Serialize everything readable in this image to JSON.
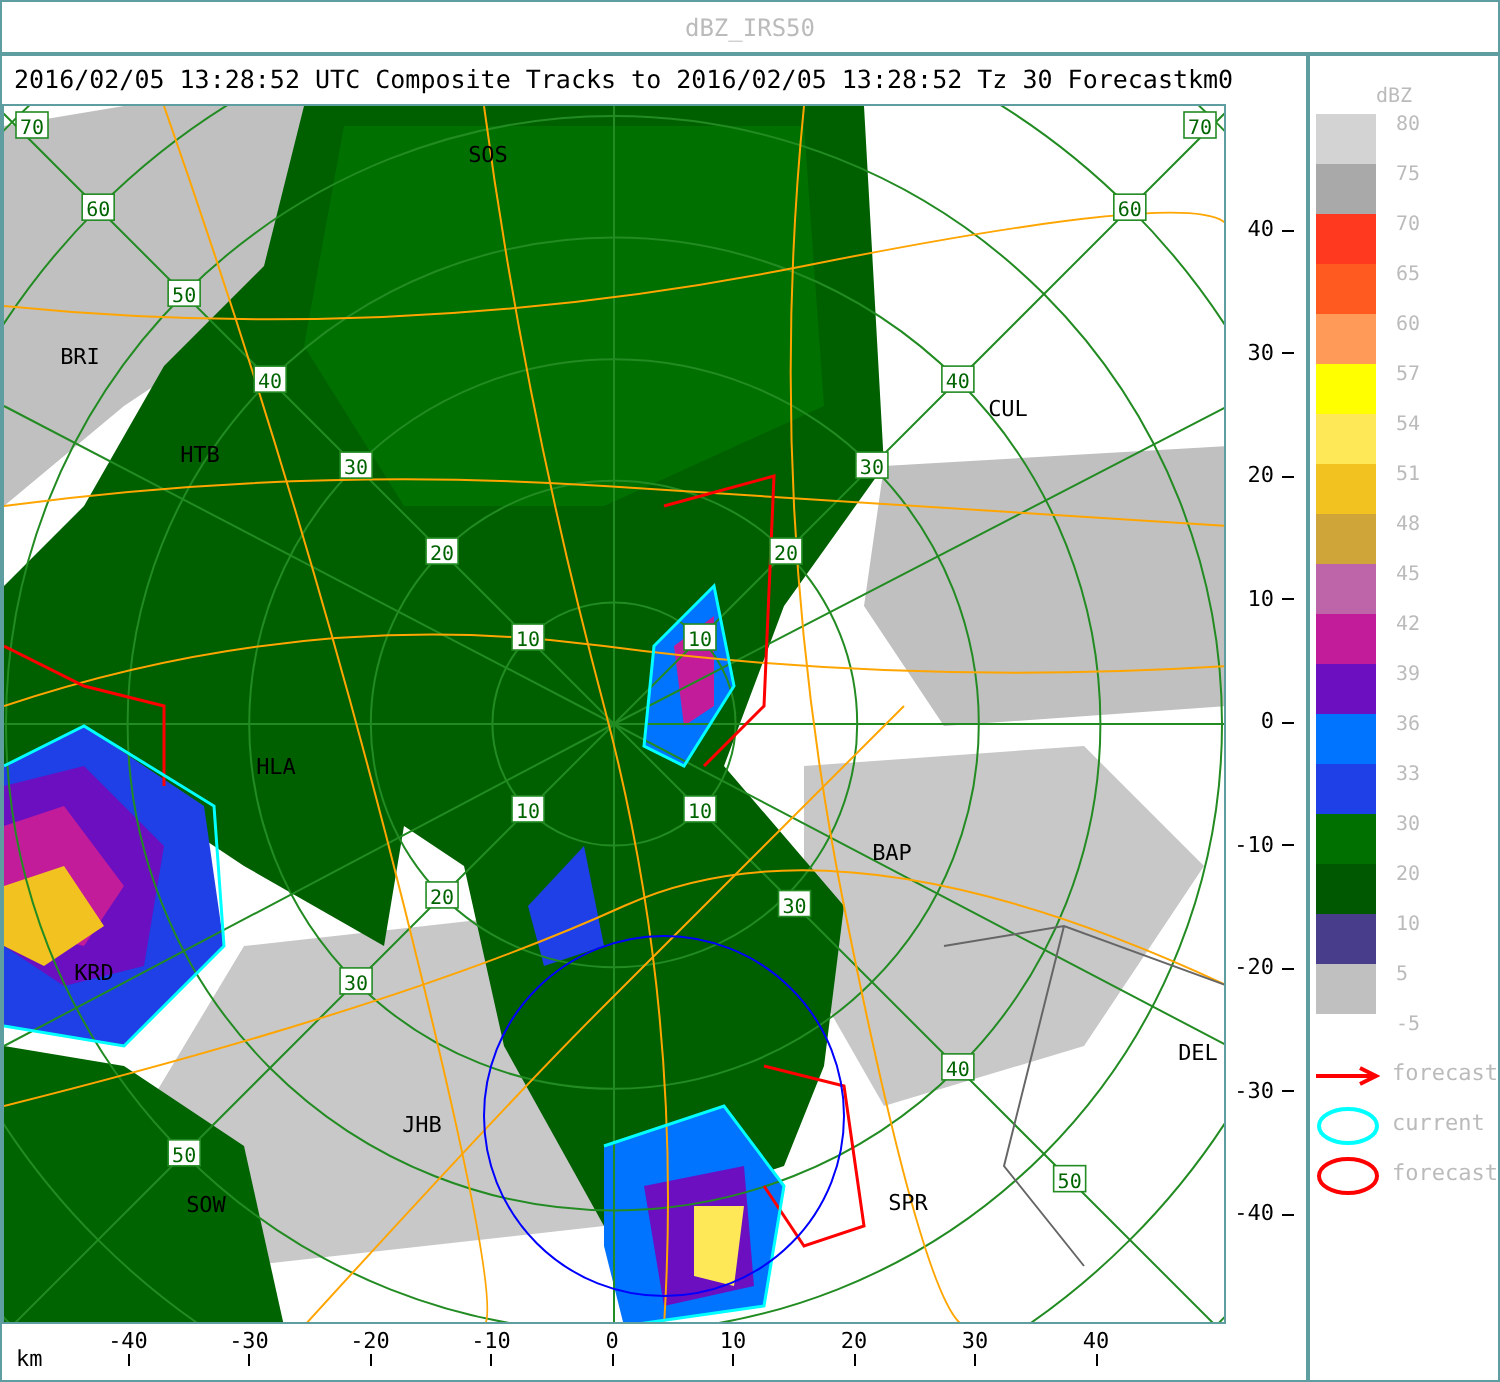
{
  "window": {
    "title": "dBZ_IRS50"
  },
  "header": "2016/02/05 13:28:52 UTC Composite Tracks to 2016/02/05 13:28:52 Tz 30 Forecastkm0",
  "map": {
    "places": [
      "SOS",
      "BRI",
      "HTB",
      "CUL",
      "HLA",
      "BAP",
      "KRD",
      "JHB",
      "DEL",
      "SPR",
      "SOW"
    ],
    "ring_labels": {
      "nw": [
        "10",
        "20",
        "30",
        "40",
        "50",
        "60",
        "70"
      ],
      "ne": [
        "10",
        "20",
        "30",
        "40",
        "60",
        "70"
      ],
      "sw": [
        "10",
        "20",
        "30",
        "50"
      ],
      "se": [
        "10",
        "30",
        "40",
        "50"
      ]
    }
  },
  "y_axis": {
    "ticks": [
      "40",
      "30",
      "20",
      "10",
      "0",
      "-10",
      "-20",
      "-30",
      "-40"
    ]
  },
  "x_axis": {
    "unit": "km",
    "ticks": [
      "-40",
      "-30",
      "-20",
      "-10",
      "0",
      "10",
      "20",
      "30",
      "40"
    ]
  },
  "legend": {
    "title": "dBZ",
    "levels": [
      {
        "label": "80",
        "color": "#d3d3d3"
      },
      {
        "label": "75",
        "color": "#a9a9a9"
      },
      {
        "label": "70",
        "color": "#ff3820"
      },
      {
        "label": "65",
        "color": "#ff5a20"
      },
      {
        "label": "60",
        "color": "#ff9a58"
      },
      {
        "label": "57",
        "color": "#ffff00"
      },
      {
        "label": "54",
        "color": "#ffe858"
      },
      {
        "label": "51",
        "color": "#f2c220"
      },
      {
        "label": "48",
        "color": "#cfa53a"
      },
      {
        "label": "45",
        "color": "#bd65a8"
      },
      {
        "label": "42",
        "color": "#c31c9b"
      },
      {
        "label": "39",
        "color": "#6b0fc0"
      },
      {
        "label": "36",
        "color": "#0073ff"
      },
      {
        "label": "33",
        "color": "#1e40e6"
      },
      {
        "label": "30",
        "color": "#007000"
      },
      {
        "label": "20",
        "color": "#005800"
      },
      {
        "label": "10",
        "color": "#483d8b"
      },
      {
        "label": "5",
        "color": "#c0c0c0"
      }
    ],
    "bottom_label": "-5",
    "keys": [
      {
        "kind": "arrow",
        "label": "forecast"
      },
      {
        "kind": "current",
        "label": "current"
      },
      {
        "kind": "forecast",
        "label": "forecast"
      }
    ]
  }
}
